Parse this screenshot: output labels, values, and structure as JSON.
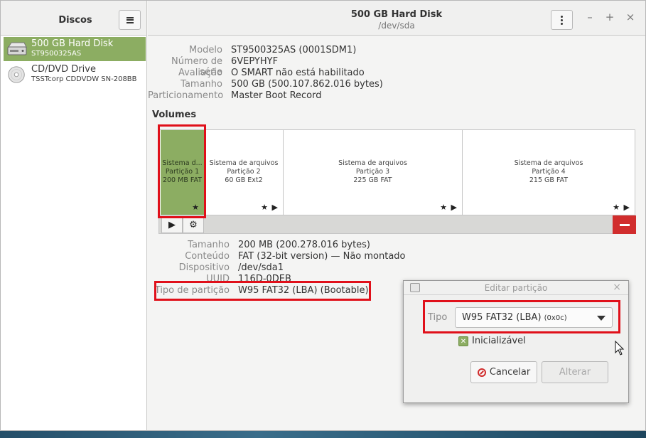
{
  "sidebar": {
    "title": "Discos",
    "disks": [
      {
        "name": "500 GB Hard Disk",
        "sub": "ST9500325AS",
        "icon": "hard-disk-icon",
        "selected": true
      },
      {
        "name": "CD/DVD Drive",
        "sub": "TSSTcorp CDDVDW SN-208BB",
        "icon": "optical-drive-icon",
        "selected": false
      }
    ]
  },
  "header": {
    "title": "500 GB Hard Disk",
    "subtitle": "/dev/sda",
    "controls": {
      "minimize": "–",
      "maximize": "+",
      "close": "×"
    }
  },
  "disk_info": [
    {
      "label": "Modelo",
      "value": "ST9500325AS (0001SDM1)"
    },
    {
      "label": "Número de série",
      "value": "6VEPYHYF"
    },
    {
      "label": "Avaliação",
      "value": "O SMART não está habilitado"
    },
    {
      "label": "Tamanho",
      "value": "500 GB (500.107.862.016 bytes)"
    },
    {
      "label": "Particionamento",
      "value": "Master Boot Record"
    }
  ],
  "volumes": {
    "title": "Volumes",
    "partitions": [
      {
        "line1": "Sistema d...",
        "line2": "Partição 1",
        "line3": "200 MB FAT",
        "marks": "★",
        "selected": true
      },
      {
        "line1": "Sistema de arquivos",
        "line2": "Partição 2",
        "line3": "60 GB Ext2",
        "marks": "★ ▶",
        "selected": false
      },
      {
        "line1": "Sistema de arquivos",
        "line2": "Partição 3",
        "line3": "225 GB FAT",
        "marks": "★ ▶",
        "selected": false
      },
      {
        "line1": "Sistema de arquivos",
        "line2": "Partição 4",
        "line3": "215 GB FAT",
        "marks": "★ ▶",
        "selected": false
      }
    ],
    "toolbar": {
      "play": "▶",
      "settings": "⚙"
    }
  },
  "partition_info": [
    {
      "label": "Tamanho",
      "value": "200 MB (200.278.016 bytes)"
    },
    {
      "label": "Conteúdo",
      "value": "FAT (32-bit version) — Não montado"
    },
    {
      "label": "Dispositivo",
      "value": "/dev/sda1"
    },
    {
      "label": "UUID",
      "value": "116D-0DEB"
    },
    {
      "label": "Tipo de partição",
      "value": "W95 FAT32 (LBA) (Bootable)"
    }
  ],
  "dialog": {
    "title": "Editar partição",
    "close": "×",
    "tipo_label": "Tipo",
    "tipo_value": "W95 FAT32 (LBA)",
    "tipo_code": "(0x0c)",
    "bootable_label": "Inicializável",
    "bootable_checked": true,
    "check_mark": "✕",
    "cancel_label": "Cancelar",
    "apply_label": "Alterar"
  },
  "colors": {
    "accent": "#8cad62",
    "highlight": "#e0101a",
    "danger": "#d12d2d"
  }
}
